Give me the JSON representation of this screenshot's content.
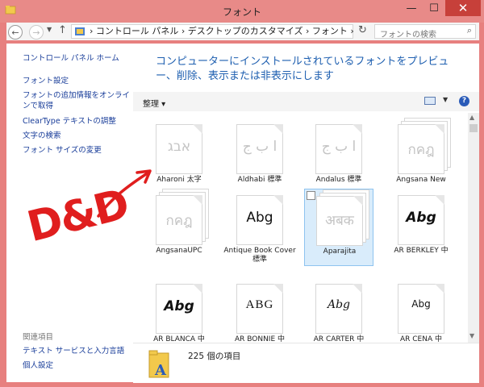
{
  "window": {
    "title": "フォント",
    "close_glyph": "✕",
    "min_glyph": "—",
    "max_glyph": "☐"
  },
  "address": {
    "crumbs": "›  コントロール パネル  ›  デスクトップのカスタマイズ  ›  フォント  ›",
    "search_placeholder": "フォントの検索"
  },
  "sidebar": {
    "home": "コントロール パネル ホーム",
    "links": [
      "フォント設定",
      "フォントの追加情報をオンラインで取得",
      "ClearType テキストの調整",
      "文字の検索",
      "フォント サイズの変更"
    ],
    "related_heading": "関連項目",
    "related": [
      "テキスト サービスと入力言語",
      "個人設定"
    ]
  },
  "main": {
    "heading": "コンピューターにインストールされているフォントをプレビュー、削除、表示または非表示にします",
    "organize_label": "整理 ▾"
  },
  "fonts": [
    {
      "name": "Aharoni 太字",
      "sample": "אבג",
      "faded": true,
      "stack": false
    },
    {
      "name": "Aldhabi 標準",
      "sample": "ا ب ج",
      "faded": true,
      "stack": false
    },
    {
      "name": "Andalus 標準",
      "sample": "ا ب ج",
      "faded": true,
      "stack": false
    },
    {
      "name": "Angsana New",
      "sample": "กคฎ",
      "faded": true,
      "stack": true
    },
    {
      "name": "AngsanaUPC",
      "sample": "กคฎ",
      "faded": true,
      "stack": true
    },
    {
      "name": "Antique Book Cover 標準",
      "sample": "Abg",
      "faded": false,
      "stack": false
    },
    {
      "name": "Aparajita",
      "sample": "अबक",
      "faded": true,
      "stack": true,
      "selected": true
    },
    {
      "name": "AR BERKLEY 中",
      "sample": "Abg",
      "faded": false,
      "stack": false
    },
    {
      "name": "AR BLANCA 中",
      "sample": "Abg",
      "faded": false,
      "stack": false
    },
    {
      "name": "AR BONNIE 中",
      "sample": "ABG",
      "faded": false,
      "stack": false
    },
    {
      "name": "AR CARTER 中",
      "sample": "Abg",
      "faded": false,
      "stack": false
    },
    {
      "name": "AR CENA 中",
      "sample": "Abg",
      "faded": false,
      "stack": false
    }
  ],
  "status": {
    "count_text": "225 個の項目"
  },
  "annotation": {
    "text": "D&D"
  },
  "colors": {
    "titlebar": "#e88a88",
    "accent_link": "#1a3e9a",
    "heading": "#1e5fb0",
    "annotation": "#e01e1e"
  }
}
